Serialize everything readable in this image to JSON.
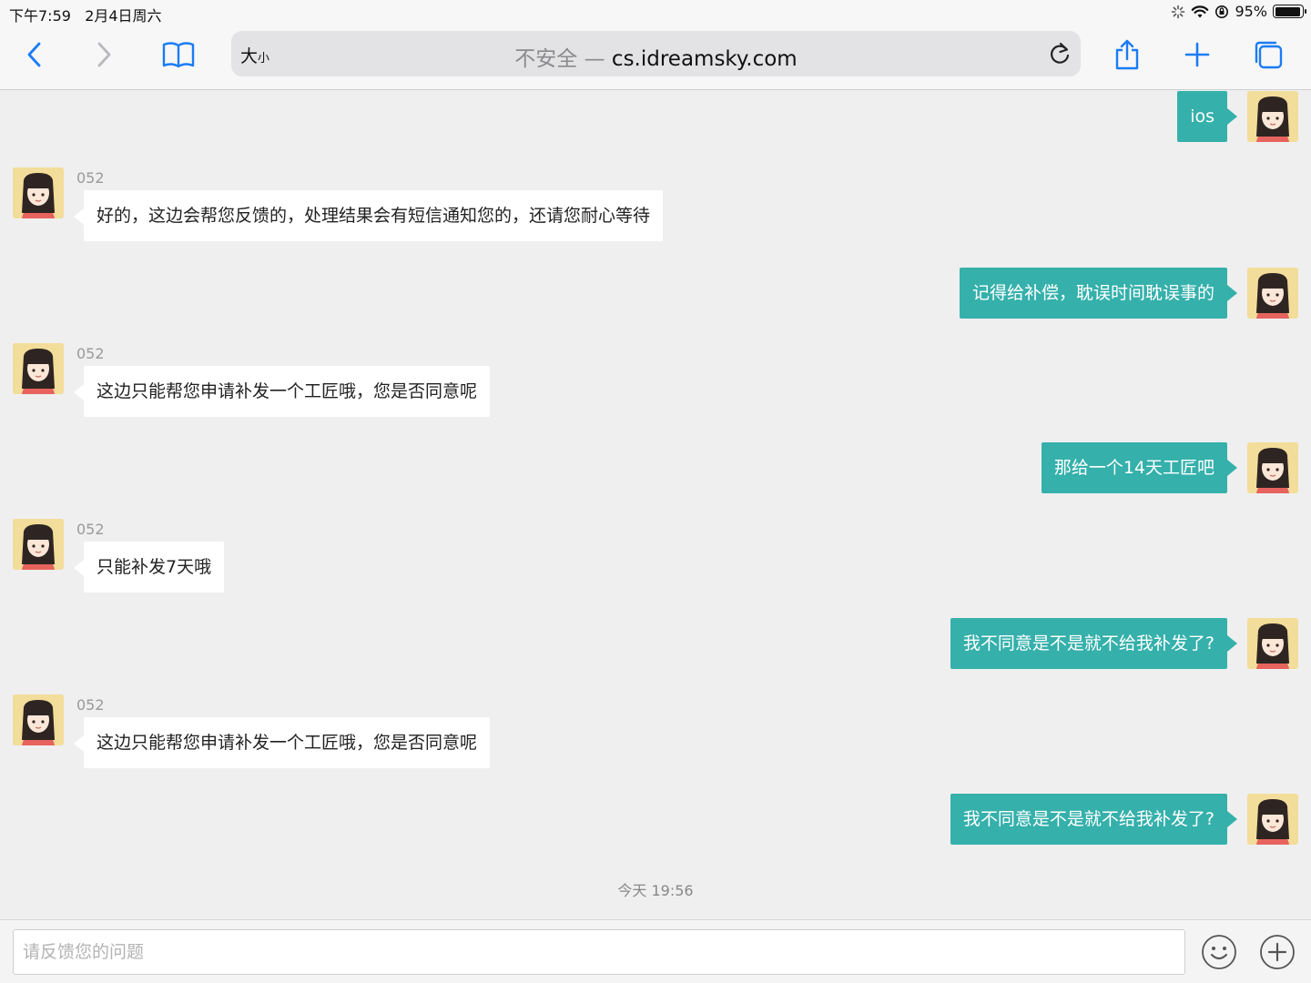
{
  "status": {
    "time_date": "下午7:59   2月4日周六",
    "battery_text": "95%",
    "battery_level": 0.95
  },
  "toolbar": {
    "text_size_big": "大",
    "text_size_small": "小",
    "insecure_label": "不安全 — ",
    "domain": "cs.idreamsky.com"
  },
  "messages": [
    {
      "side": "right",
      "text": "ios"
    },
    {
      "side": "left",
      "sender": "052",
      "text": "好的，这边会帮您反馈的，处理结果会有短信通知您的，还请您耐心等待"
    },
    {
      "side": "right",
      "text": "记得给补偿，耽误时间耽误事的"
    },
    {
      "side": "left",
      "sender": "052",
      "text": "这边只能帮您申请补发一个工匠哦，您是否同意呢"
    },
    {
      "side": "right",
      "text": "那给一个14天工匠吧"
    },
    {
      "side": "left",
      "sender": "052",
      "text": "只能补发7天哦"
    },
    {
      "side": "right",
      "text": "我不同意是不是就不给我补发了?"
    },
    {
      "side": "left",
      "sender": "052",
      "text": "这边只能帮您申请补发一个工匠哦，您是否同意呢"
    },
    {
      "side": "right",
      "text": "我不同意是不是就不给我补发了?"
    }
  ],
  "timestamp": "今天 19:56",
  "composer": {
    "placeholder": "请反馈您的问题"
  },
  "colors": {
    "accent_bubble": "#35b0ab",
    "ios_blue": "#1a7cf5",
    "avatar_bg": "#f3dd9a"
  }
}
